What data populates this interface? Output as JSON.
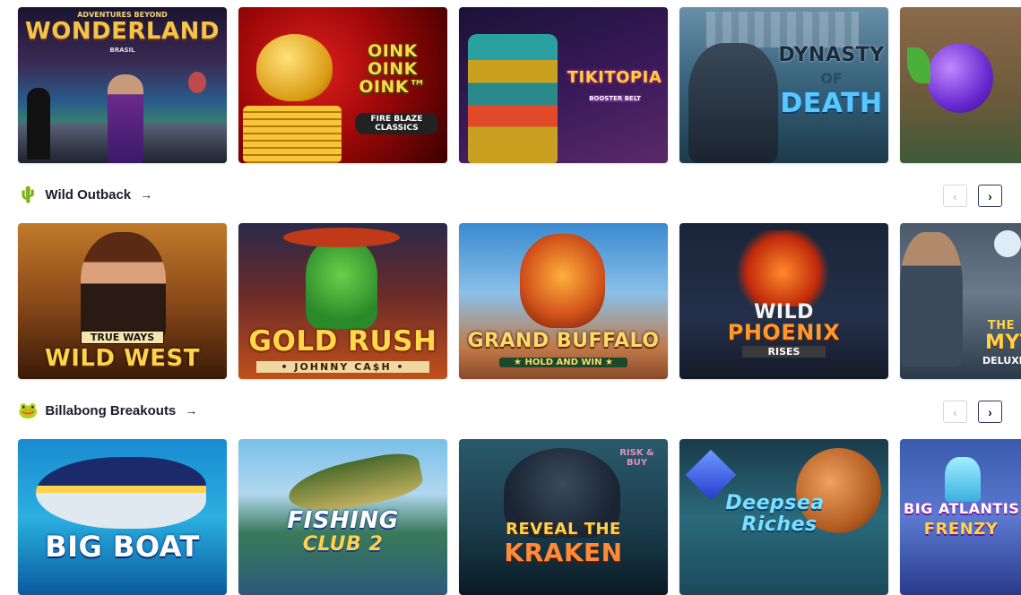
{
  "row1": {
    "tiles": [
      {
        "name": "adventures-beyond-wonderland",
        "pre": "ADVENTURES BEYOND",
        "title": "WONDERLAND",
        "sub": "BRASIL"
      },
      {
        "name": "oink-oink-oink",
        "title": "OINK OINK OINK™",
        "sub": "FIRE BLAZE CLASSICS"
      },
      {
        "name": "tikitopia",
        "title": "TIKITOPIA",
        "sub": "BOOSTER BELT"
      },
      {
        "name": "dynasty-of-death",
        "title": "DYNASTY",
        "sub": "OF",
        "title2": "DEATH"
      },
      {
        "name": "plum-game",
        "title": ""
      }
    ]
  },
  "sections": [
    {
      "emoji": "🌵",
      "title": "Wild Outback",
      "arrow": "→"
    },
    {
      "emoji": "🐸",
      "title": "Billabong Breakouts",
      "arrow": "→"
    }
  ],
  "nav": {
    "prev": "‹",
    "next": "›"
  },
  "row2": {
    "tiles": [
      {
        "name": "true-ways-wild-west",
        "pre": "TRUE WAYS",
        "title": "WILD WEST"
      },
      {
        "name": "gold-rush-johnny-cash",
        "title": "GOLD RUSH",
        "sub": "• JOHNNY CA$H •"
      },
      {
        "name": "grand-buffalo",
        "title": "GRAND BUFFALO",
        "sub": "★ HOLD AND WIN ★"
      },
      {
        "name": "wild-phoenix-rises",
        "title": "WILD",
        "title2": "PHOENIX",
        "sub": "RISES"
      },
      {
        "name": "the-myth-deluxe",
        "title": "THE",
        "title2": "MYT",
        "sub": "DELUXE"
      }
    ]
  },
  "row3": {
    "tiles": [
      {
        "name": "big-boat",
        "title": "BIG BOAT"
      },
      {
        "name": "fishing-club-2",
        "title": "FISHING",
        "title2": "CLUB 2"
      },
      {
        "name": "reveal-the-kraken",
        "pre": "RISK & BUY",
        "title": "REVEAL THE",
        "title2": "KRAKEN"
      },
      {
        "name": "deepsea-riches",
        "title": "Deepsea",
        "title2": "Riches"
      },
      {
        "name": "big-atlantis-frenzy",
        "title": "BIG ATLANTIS",
        "title2": "FRENZY"
      }
    ]
  },
  "colors": {
    "accent": "#2f3a63",
    "border": "#d5d8de"
  }
}
